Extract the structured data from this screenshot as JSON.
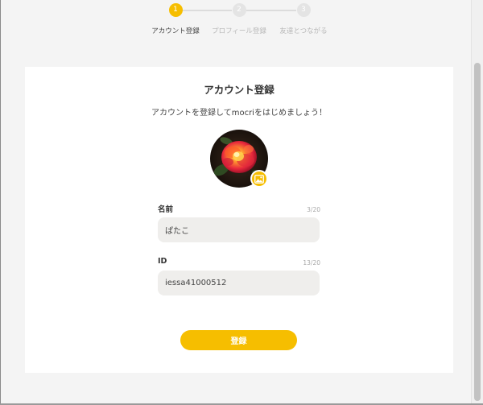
{
  "stepper": {
    "steps": [
      {
        "number": "1",
        "label": "アカウント登録",
        "active": true
      },
      {
        "number": "2",
        "label": "プロフィール登録",
        "active": false
      },
      {
        "number": "3",
        "label": "友達とつながる",
        "active": false
      }
    ]
  },
  "form": {
    "title": "アカウント登録",
    "subtitle": "アカウントを登録してmocriをはじめましょう！",
    "avatar_icon": "rose-photo",
    "avatar_edit_icon": "image-icon",
    "name_label": "名前",
    "name_count": "3/20",
    "name_value": "ぱたこ",
    "id_label": "ID",
    "id_count": "13/20",
    "id_value": "iessa41000512",
    "submit_label": "登録"
  },
  "colors": {
    "accent": "#f6be00",
    "input_bg": "#efeeec",
    "page_bg": "#f4f4f4"
  }
}
